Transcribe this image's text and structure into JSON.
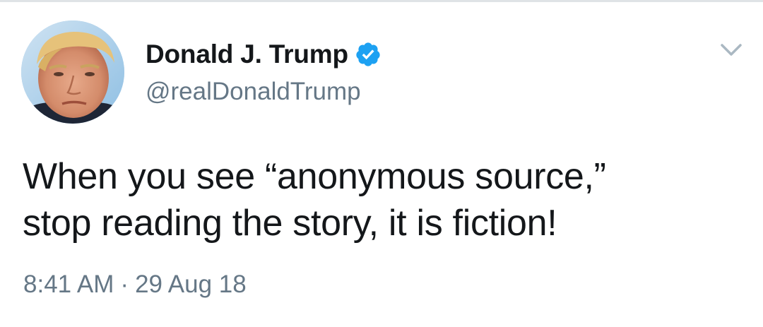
{
  "user": {
    "display_name": "Donald J. Trump",
    "handle": "@realDonaldTrump",
    "verified": true,
    "avatar_icon": "profile-photo"
  },
  "tweet": {
    "text_lines": [
      "When you see “anonymous source,”",
      "stop reading the story, it is fiction!"
    ],
    "time": "8:41 AM",
    "separator": "·",
    "date": "29 Aug 18"
  },
  "icons": {
    "verified": "verified-badge-icon",
    "menu": "chevron-down-icon"
  },
  "colors": {
    "text_primary": "#14171a",
    "text_secondary": "#657786",
    "verified_blue": "#1da1f2",
    "caret": "#aab8c2",
    "divider": "#dfe3e6"
  }
}
